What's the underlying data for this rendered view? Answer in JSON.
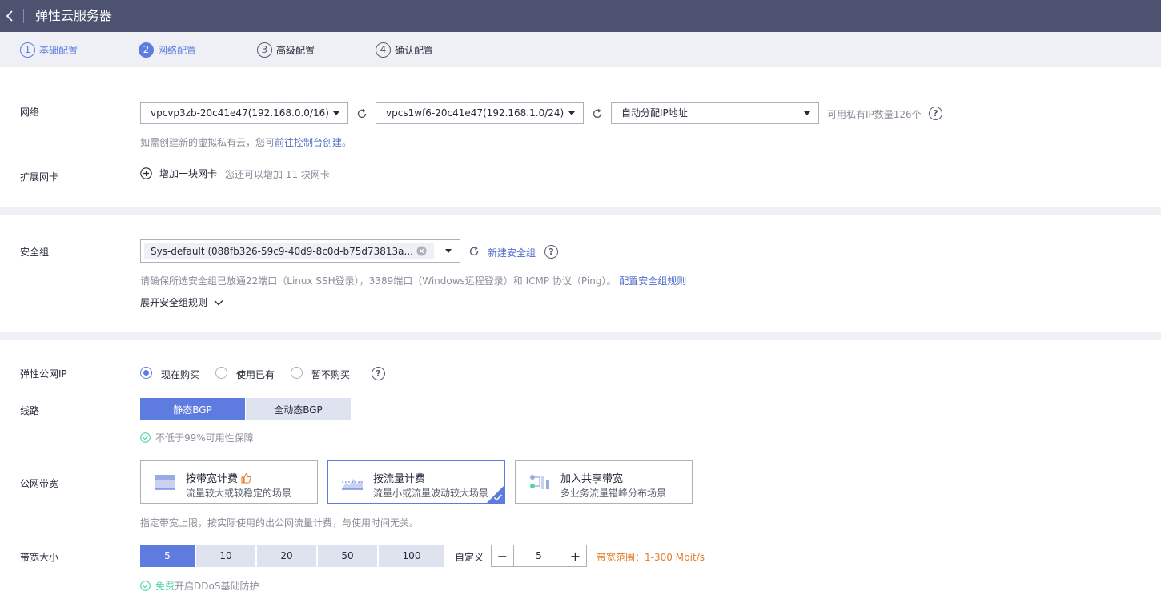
{
  "header": {
    "title": "弹性云服务器"
  },
  "steps": [
    {
      "num": "1",
      "label": "基础配置"
    },
    {
      "num": "2",
      "label": "网络配置"
    },
    {
      "num": "3",
      "label": "高级配置"
    },
    {
      "num": "4",
      "label": "确认配置"
    }
  ],
  "network": {
    "label": "网络",
    "vpc_select": "vpcvp3zb-20c41e47(192.168.0.0/16)",
    "subnet_select": "vpcs1wf6-20c41e47(192.168.1.0/24)",
    "ip_select": "自动分配IP地址",
    "ip_count": "可用私有IP数量126个",
    "hint_prefix": "如需创建新的虚拟私有云，您可",
    "hint_link": "前往控制台创建",
    "hint_suffix": "。"
  },
  "nic": {
    "label": "扩展网卡",
    "add_label": "增加一块网卡",
    "hint": "您还可以增加 11 块网卡"
  },
  "security": {
    "label": "安全组",
    "selected": "Sys-default (088fb326-59c9-40d9-8c0d-b75d73813a...",
    "new_link": "新建安全组",
    "hint": "请确保所选安全组已放通22端口（Linux SSH登录），3389端口（Windows远程登录）和 ICMP 协议（Ping）。",
    "hint_link": "配置安全组规则",
    "expand": "展开安全组规则"
  },
  "eip": {
    "label": "弹性公网IP",
    "options": [
      "现在购买",
      "使用已有",
      "暂不购买"
    ]
  },
  "line": {
    "label": "线路",
    "options": [
      "静态BGP",
      "全动态BGP"
    ],
    "note": "不低于99%可用性保障"
  },
  "bandwidth": {
    "label": "公网带宽",
    "cards": [
      {
        "title": "按带宽计费",
        "sub": "流量较大或较稳定的场景"
      },
      {
        "title": "按流量计费",
        "sub": "流量小或流量波动较大场景"
      },
      {
        "title": "加入共享带宽",
        "sub": "多业务流量错峰分布场景"
      }
    ],
    "hint": "指定带宽上限，按实际使用的出公网流量计费，与使用时间无关。"
  },
  "size": {
    "label": "带宽大小",
    "options": [
      "5",
      "10",
      "20",
      "50",
      "100"
    ],
    "custom_label": "自定义",
    "value": "5",
    "range": "带宽范围：1-300 Mbit/s",
    "ddos_free": "免费",
    "ddos_text": "开启DDoS基础防护"
  },
  "colors": {
    "accent": "#5e7ce0",
    "header": "#4c5270",
    "success": "#50d4ab",
    "warning": "#e37d29"
  }
}
